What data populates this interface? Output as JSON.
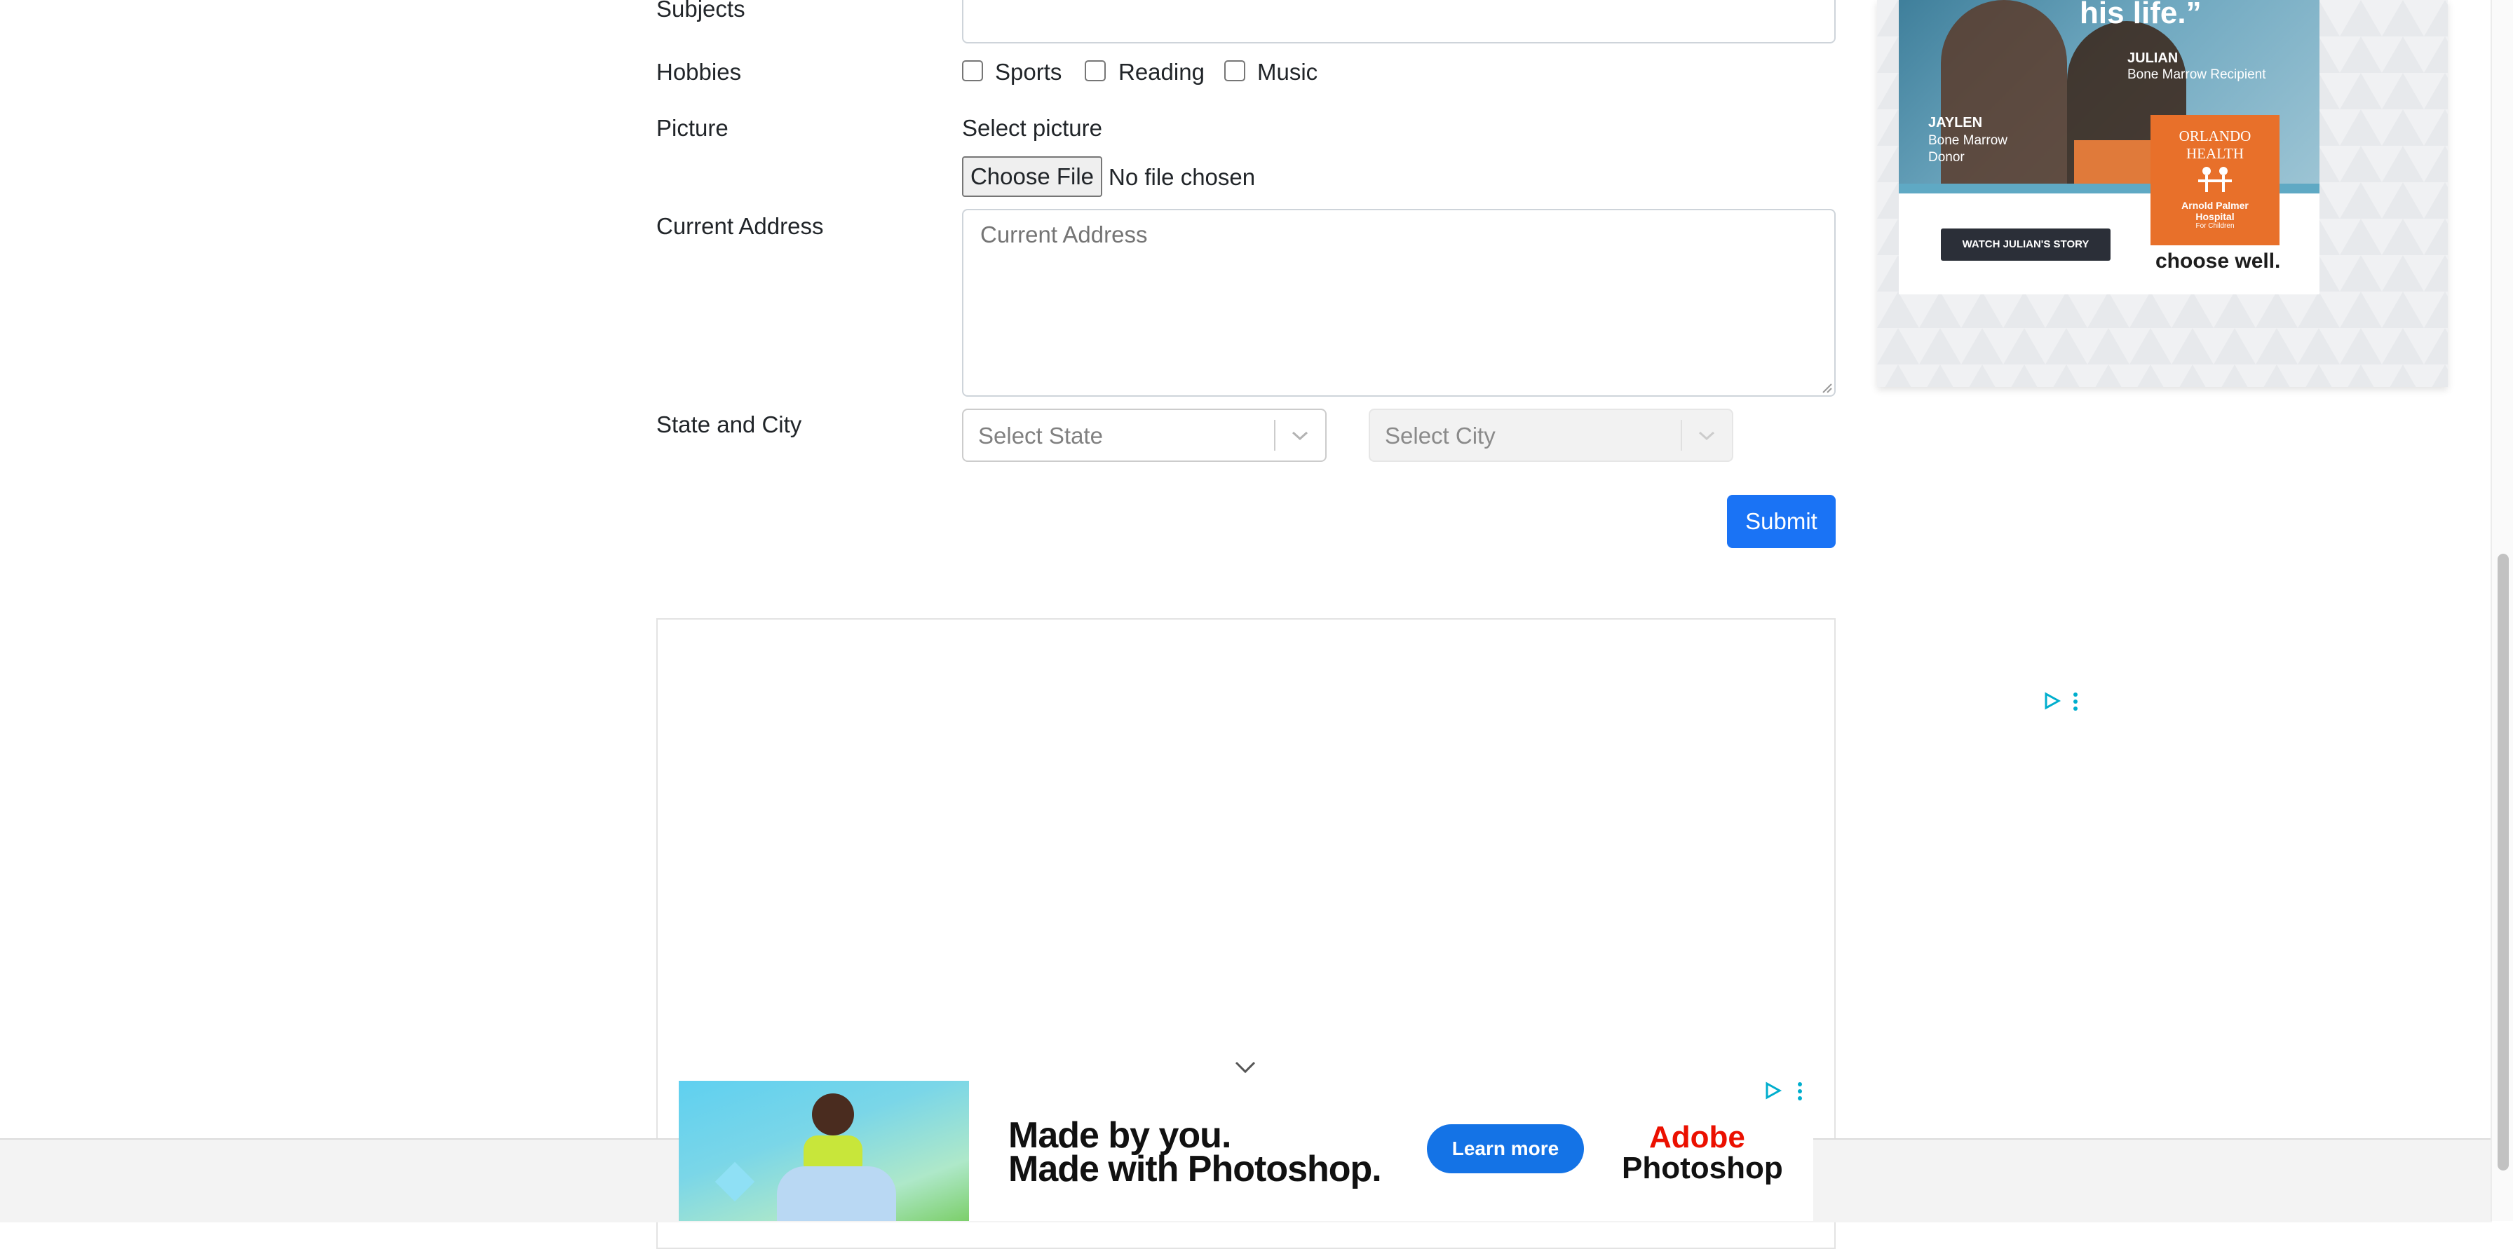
{
  "form": {
    "subjects_label": "Subjects",
    "hobbies_label": "Hobbies",
    "hobbies": [
      {
        "label": "Sports",
        "checked": false
      },
      {
        "label": "Reading",
        "checked": false
      },
      {
        "label": "Music",
        "checked": false
      }
    ],
    "picture_label": "Picture",
    "select_picture": "Select picture",
    "choose_file": "Choose File",
    "no_file": "No file chosen",
    "address_label": "Current Address",
    "address_placeholder": "Current Address",
    "state_city_label": "State and City",
    "state_placeholder": "Select State",
    "city_placeholder": "Select City",
    "submit": "Submit"
  },
  "ad_right": {
    "quote_tail": "his life.”",
    "recipient_name": "JULIAN",
    "recipient_role": "Bone Marrow Recipient",
    "donor_name": "JAYLEN",
    "donor_role_1": "Bone Marrow",
    "donor_role_2": "Donor",
    "brand_1": "ORLANDO",
    "brand_2": "HEALTH",
    "hospital_1": "Arnold Palmer",
    "hospital_2": "Hospital",
    "hospital_3": "For Children",
    "cta": "WATCH JULIAN'S STORY",
    "tagline": "choose well."
  },
  "ad_bottom": {
    "headline_1": "Made by you.",
    "headline_2": "Made with Photoshop.",
    "cta": "Learn more",
    "brand_1": "Adobe",
    "brand_2": "Photoshop"
  },
  "colors": {
    "primary": "#1a73f5",
    "orange": "#e8702a",
    "adobe_red": "#eb1000",
    "ad_blue": "#1473e6"
  }
}
